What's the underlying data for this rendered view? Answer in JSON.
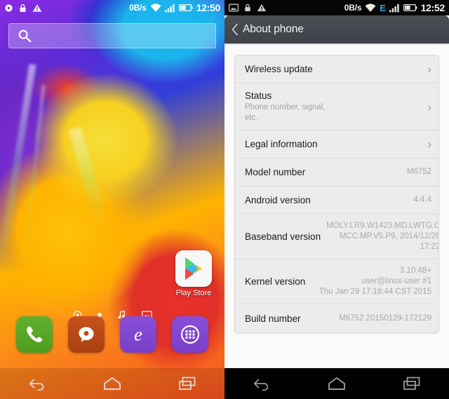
{
  "home": {
    "statusbar": {
      "left_icons": [
        "alarm-icon",
        "lock-icon",
        "warning-icon"
      ],
      "data_rate": "0B/s",
      "right_icons": [
        "wifi-icon",
        "signal-icon",
        "battery-icon"
      ],
      "clock": "12:50"
    },
    "search": {
      "placeholder": "",
      "value": "",
      "icon": "search-icon"
    },
    "play_store": {
      "label": "Play Store",
      "icon": "play-store-icon"
    },
    "page_indicators": [
      "home-target-icon",
      "page-dot",
      "music-note-icon",
      "wallpaper-icon"
    ],
    "dock": [
      {
        "name": "phone",
        "icon": "phone-icon"
      },
      {
        "name": "messaging",
        "icon": "message-icon"
      },
      {
        "name": "browser",
        "icon": "browser-e-icon"
      },
      {
        "name": "app-drawer",
        "icon": "app-drawer-icon"
      }
    ],
    "navbar": [
      "back-icon",
      "home-icon",
      "recents-icon"
    ]
  },
  "settings": {
    "statusbar": {
      "left_icons": [
        "screenshot-icon",
        "lock-icon",
        "warning-icon"
      ],
      "data_rate": "0B/s",
      "network_type": "E",
      "network_color": "#2ba8e0",
      "right_icons": [
        "wifi-icon",
        "signal-icon",
        "battery-icon"
      ],
      "clock": "12:52"
    },
    "actionbar": {
      "back_icon": "chevron-left-icon",
      "title": "About phone"
    },
    "rows": [
      {
        "title": "Wireless update",
        "sub": "",
        "value": "",
        "chevron": "true"
      },
      {
        "title": "Status",
        "sub": "Phone number, signal, etc.",
        "value": "",
        "chevron": "true"
      },
      {
        "title": "Legal information",
        "sub": "",
        "value": "",
        "chevron": "true"
      },
      {
        "title": "Model number",
        "sub": "",
        "value": "M6752",
        "chevron": "false"
      },
      {
        "title": "Android version",
        "sub": "",
        "value": "4.4.4",
        "chevron": "false"
      },
      {
        "title": "Baseband version",
        "sub": "",
        "value": "MOLY.LR9.W1423.MD.LWTG.C\nMCC.MP.V5.P9, 2014/12/26\n17:22",
        "chevron": "false"
      },
      {
        "title": "Kernel version",
        "sub": "",
        "value": "3.10.48+\nuser@linux-user #1\nThu Jan 29 17:18:44 CST 2015",
        "chevron": "false"
      },
      {
        "title": "Build number",
        "sub": "",
        "value": "M6752 20150129-172129",
        "chevron": "false"
      }
    ],
    "navbar": [
      "back-icon",
      "home-icon",
      "recents-icon"
    ]
  }
}
